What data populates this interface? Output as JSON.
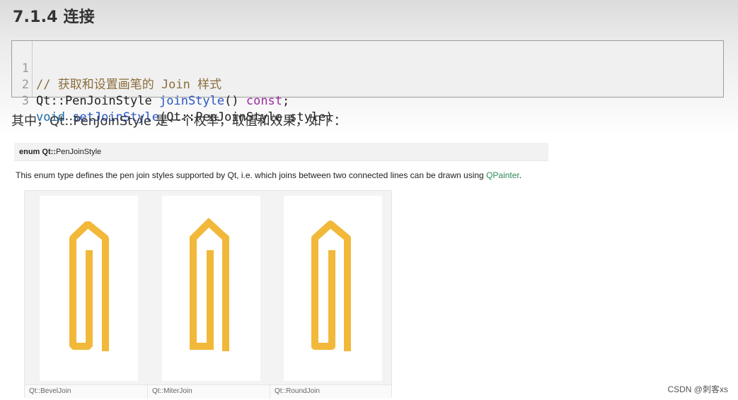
{
  "heading": "7.1.4 连接",
  "code": {
    "lines": [
      {
        "n": "1",
        "comment": "// 获取和设置画笔的 Join 样式"
      },
      {
        "n": "2",
        "type": "Qt::PenJoinStyle ",
        "fn": "joinStyle",
        "rest": "() ",
        "kw": "const",
        "end": ";"
      },
      {
        "n": "3",
        "kw": "void ",
        "fn": "setJoinStyle",
        "rest": "(Qt::PenJoinStyle style)"
      }
    ]
  },
  "intro": "其中，Qt::PenJoinStyle 是一个枚举，取值和效果，如下：",
  "doc": {
    "enum_prefix": "enum Qt::",
    "enum_name": "PenJoinStyle",
    "description": "This enum type defines the pen join styles supported by Qt, i.e. which joins between two connected lines can be drawn using ",
    "link": "QPainter",
    "description_end": "."
  },
  "figure": {
    "stroke_color": "#f2b83a",
    "captions": [
      "Qt::BevelJoin",
      "Qt::MiterJoin",
      "Qt::RoundJoin"
    ]
  },
  "watermark": "CSDN @刺客xs"
}
